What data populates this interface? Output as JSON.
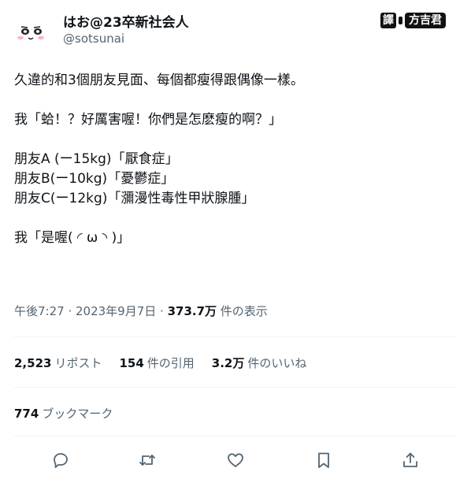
{
  "author": {
    "display_name": "はお@23卒新社会人",
    "handle": "@sotsunai"
  },
  "watermark": {
    "tag": "譯",
    "name": "方吉君"
  },
  "tweet": {
    "lines": [
      "久違的和3個朋友見面、每個都瘦得跟偶像一樣。",
      "",
      "我「蛤！？好厲害喔！你們是怎麽瘦的啊？」",
      "",
      "朋友A (ー15kg)「厭食症」",
      "朋友B(ー10kg)「憂鬱症」",
      "朋友C(ー12kg)「瀰漫性毒性甲狀腺腫」",
      "",
      "我「是喔( ◜ ω ◝ )」"
    ]
  },
  "meta": {
    "time": "午後7:27",
    "separator": " · ",
    "date": "2023年9月7日",
    "views_count": "373.7万",
    "views_label": " 件の表示"
  },
  "stats": {
    "retweets_count": "2,523",
    "retweets_label": "リポスト",
    "quotes_count": "154",
    "quotes_label": "件の引用",
    "likes_count": "3.2万",
    "likes_label": "件のいいね"
  },
  "bookmarks": {
    "count": "774",
    "label": "ブックマーク"
  },
  "actions": [
    {
      "icon": "reply-icon"
    },
    {
      "icon": "retweet-icon"
    },
    {
      "icon": "like-icon"
    },
    {
      "icon": "bookmark-icon"
    },
    {
      "icon": "share-icon"
    }
  ]
}
